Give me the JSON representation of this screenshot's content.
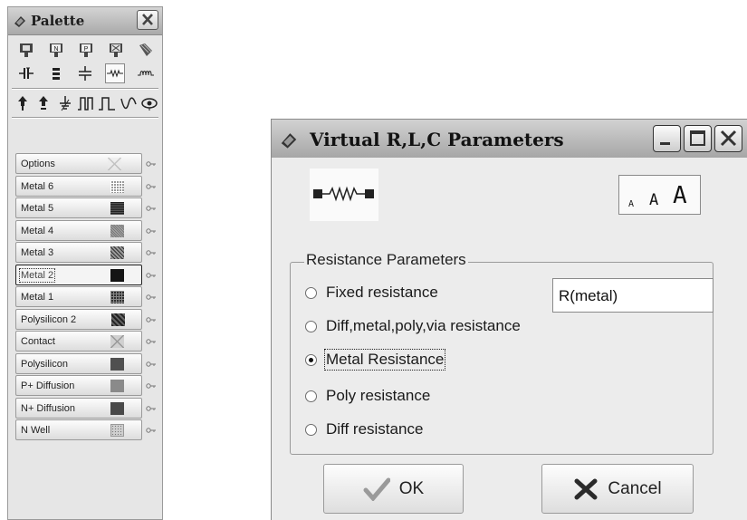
{
  "palette": {
    "title": "Palette",
    "icons_row1": [
      "nmos-icon",
      "n-cell-icon",
      "p-cell-icon",
      "contact-cell-icon",
      "via-cell-icon"
    ],
    "icons_row2": [
      "capacitor-icon",
      "bus-icon",
      "ground-icon",
      "resistor-icon",
      "inductor-icon"
    ],
    "icons_row3": [
      "up-arrow-icon",
      "clock-icon",
      "ground-symbol-icon",
      "pulse-icon",
      "square-wave-icon",
      "sine-icon",
      "eye-icon"
    ],
    "layers": [
      {
        "label": "Options",
        "swatch": "#ececec",
        "pattern": "cross-light",
        "selected": false
      },
      {
        "label": "Metal 6",
        "swatch": "#9a9a9a",
        "pattern": "grid",
        "selected": false
      },
      {
        "label": "Metal 5",
        "swatch": "#3a3a3a",
        "pattern": "hstripes",
        "selected": false
      },
      {
        "label": "Metal 4",
        "swatch": "#8f8f8f",
        "pattern": "fine",
        "selected": false
      },
      {
        "label": "Metal 3",
        "swatch": "#6c6c6c",
        "pattern": "diag",
        "selected": false
      },
      {
        "label": "Metal 2",
        "swatch": "#151515",
        "pattern": "solid",
        "selected": true
      },
      {
        "label": "Metal 1",
        "swatch": "#2e2e2e",
        "pattern": "grid-dark",
        "selected": false
      },
      {
        "label": "Polysilicon 2",
        "swatch": "#3c3c3c",
        "pattern": "checker",
        "selected": false
      },
      {
        "label": "Contact",
        "swatch": "#d0d0d0",
        "pattern": "cross",
        "selected": false
      },
      {
        "label": "Polysilicon",
        "swatch": "#505050",
        "pattern": "solid",
        "selected": false
      },
      {
        "label": "P+ Diffusion",
        "swatch": "#8a8a8a",
        "pattern": "solid",
        "selected": false
      },
      {
        "label": "N+ Diffusion",
        "swatch": "#4a4a4a",
        "pattern": "solid",
        "selected": false
      },
      {
        "label": "N Well",
        "swatch": "#cfcfcf",
        "pattern": "dots",
        "selected": false
      }
    ]
  },
  "dialog": {
    "title": "Virtual R,L,C Parameters",
    "font_sizes": [
      "A",
      "A",
      "A"
    ],
    "group_title": "Resistance Parameters",
    "options": [
      {
        "label": "Fixed resistance",
        "selected": false
      },
      {
        "label": "Diff,metal,poly,via resistance",
        "selected": false
      },
      {
        "label": "Metal Resistance",
        "selected": true
      },
      {
        "label": "Poly resistance",
        "selected": false
      },
      {
        "label": "Diff resistance",
        "selected": false
      }
    ],
    "value_field": "R(metal)",
    "ok_label": "OK",
    "cancel_label": "Cancel"
  }
}
